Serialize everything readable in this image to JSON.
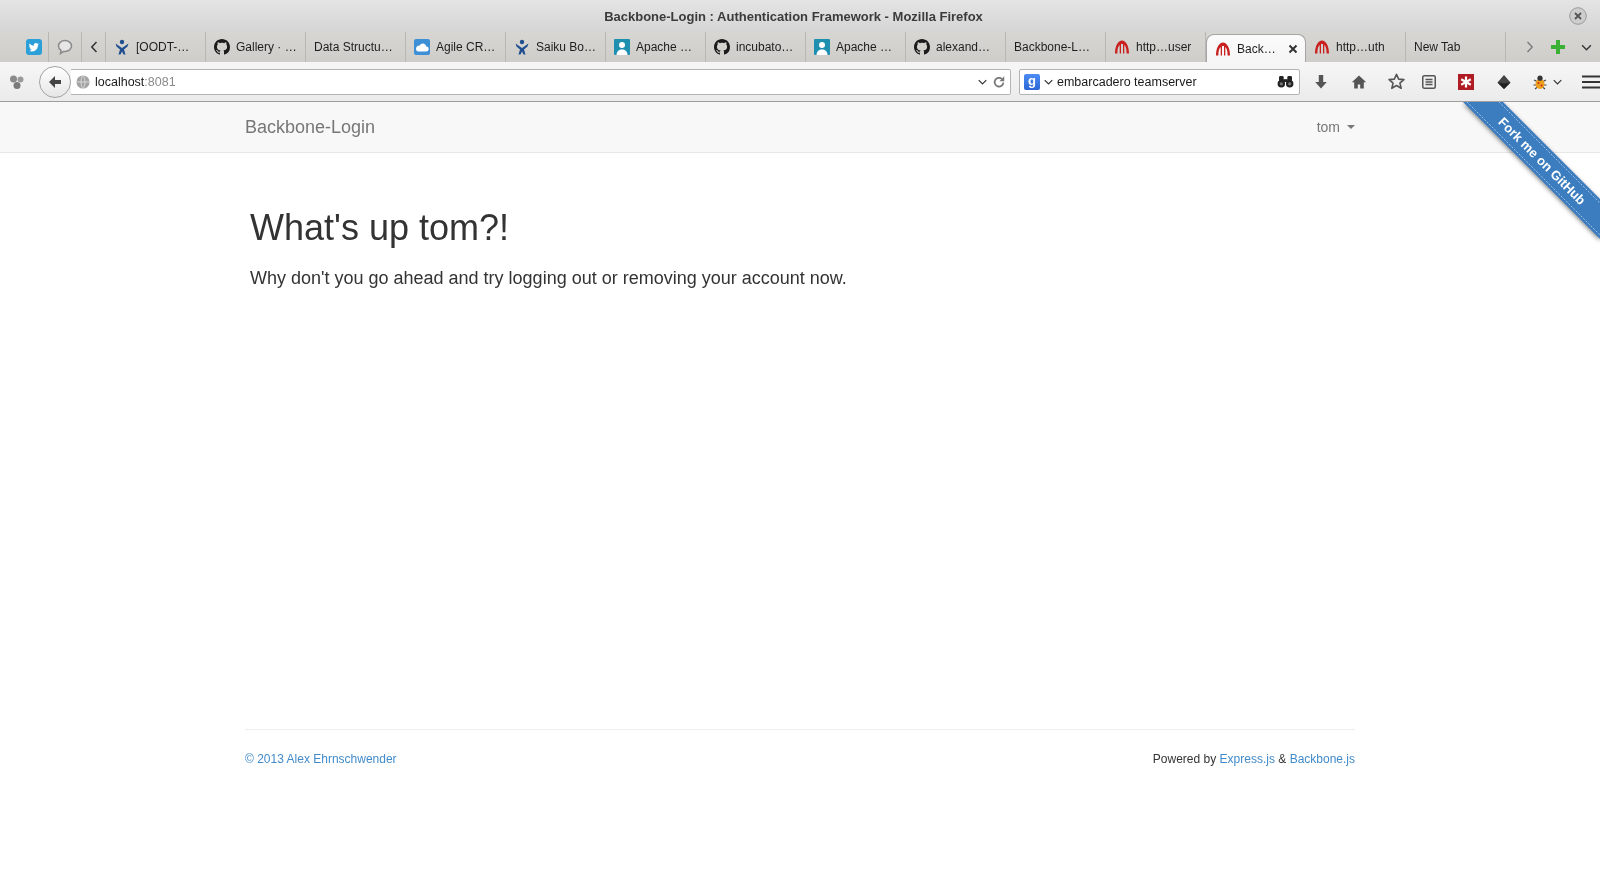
{
  "window": {
    "title": "Backbone-Login : Authentication Framework - Mozilla Firefox"
  },
  "tabs": [
    {
      "label": "[OODT-…",
      "selected": false
    },
    {
      "label": "Gallery · …",
      "selected": false
    },
    {
      "label": "Data Structu…",
      "selected": false
    },
    {
      "label": "Agile CR…",
      "selected": false
    },
    {
      "label": "Saiku Bo…",
      "selected": false
    },
    {
      "label": "Apache …",
      "selected": false
    },
    {
      "label": "incubato…",
      "selected": false
    },
    {
      "label": "Apache …",
      "selected": false
    },
    {
      "label": "alexand…",
      "selected": false
    },
    {
      "label": "Backbone-L…",
      "selected": false
    },
    {
      "label": "http…user",
      "selected": false
    },
    {
      "label": "Back…",
      "selected": true
    },
    {
      "label": "http…uth",
      "selected": false
    },
    {
      "label": "New Tab",
      "selected": false
    }
  ],
  "address_bar": {
    "host": "localhost",
    "port": ":8081"
  },
  "search_bar": {
    "engine": "g",
    "value": "embarcadero teamserver"
  },
  "navbar": {
    "brand": "Backbone-Login",
    "user": "tom"
  },
  "ribbon": {
    "label": "Fork me on GitHub"
  },
  "content": {
    "heading": "What's up tom?!",
    "text": "Why don't you go ahead and try logging out or removing your account now."
  },
  "footer": {
    "copyright": "© 2013 Alex Ehrnschwender",
    "credits": [
      {
        "kind": "text",
        "text": "Powered by"
      },
      {
        "kind": "link",
        "text": "Express.js"
      },
      {
        "kind": "text",
        "text": "&"
      },
      {
        "kind": "link",
        "text": "Backbone.js"
      }
    ]
  }
}
